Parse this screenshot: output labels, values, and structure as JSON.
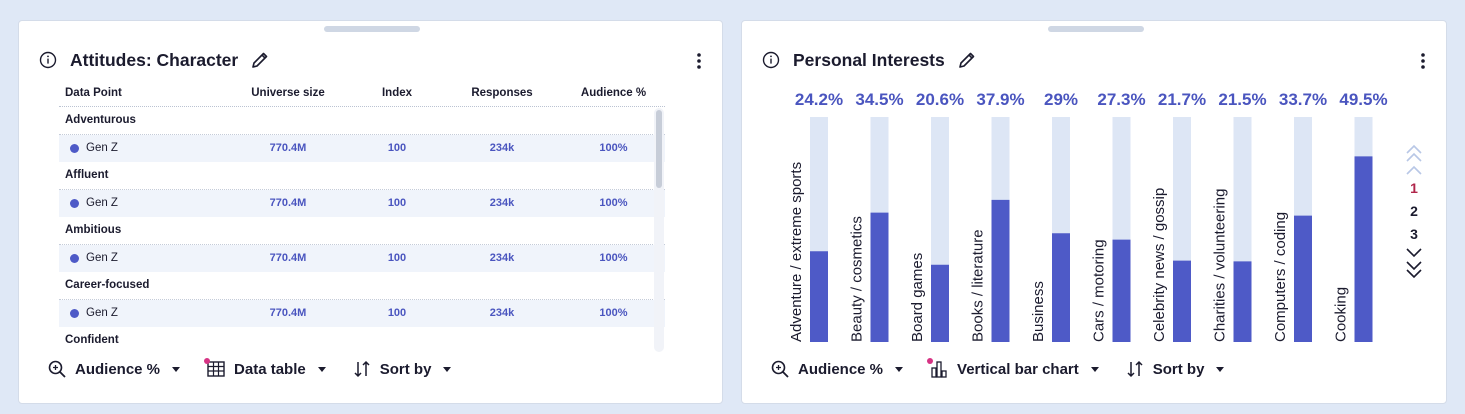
{
  "left_panel": {
    "title": "Attitudes: Character",
    "columns": [
      "Data Point",
      "Universe size",
      "Index",
      "Responses",
      "Audience %"
    ],
    "groups": [
      {
        "name": "Adventurous",
        "rows": [
          {
            "label": "Gen Z",
            "universe": "770.4M",
            "index": "100",
            "responses": "234k",
            "audience": "100%"
          }
        ]
      },
      {
        "name": "Affluent",
        "rows": [
          {
            "label": "Gen Z",
            "universe": "770.4M",
            "index": "100",
            "responses": "234k",
            "audience": "100%"
          }
        ]
      },
      {
        "name": "Ambitious",
        "rows": [
          {
            "label": "Gen Z",
            "universe": "770.4M",
            "index": "100",
            "responses": "234k",
            "audience": "100%"
          }
        ]
      },
      {
        "name": "Career-focused",
        "rows": [
          {
            "label": "Gen Z",
            "universe": "770.4M",
            "index": "100",
            "responses": "234k",
            "audience": "100%"
          }
        ]
      },
      {
        "name": "Confident",
        "rows": []
      }
    ],
    "footer": {
      "metric_label": "Audience %",
      "view_label": "Data table",
      "sort_label": "Sort by"
    }
  },
  "right_panel": {
    "title": "Personal Interests",
    "footer": {
      "metric_label": "Audience %",
      "view_label": "Vertical bar chart",
      "sort_label": "Sort by"
    },
    "pager": {
      "pages": [
        "1",
        "2",
        "3"
      ],
      "current": "1"
    }
  },
  "chart_data": {
    "type": "bar",
    "orientation": "vertical",
    "categories": [
      "Adventure / extreme sports",
      "Beauty / cosmetics",
      "Board games",
      "Books / literature",
      "Business",
      "Cars / motoring",
      "Celebrity news / gossip",
      "Charities / volunteering",
      "Computers / coding",
      "Cooking"
    ],
    "values": [
      24.2,
      34.5,
      20.6,
      37.9,
      29,
      27.3,
      21.7,
      21.5,
      33.7,
      49.5
    ],
    "value_labels": [
      "24.2%",
      "34.5%",
      "20.6%",
      "37.9%",
      "29%",
      "27.3%",
      "21.7%",
      "21.5%",
      "33.7%",
      "49.5%"
    ],
    "ylim": [
      0,
      60
    ],
    "grid": false,
    "colors": {
      "bar": "#4e5ac7",
      "track": "#dde6f5",
      "label": "#4a55bf"
    }
  },
  "colors": {
    "accent": "#4a55bf",
    "background": "#dfe8f6",
    "pager_active": "#b0254a",
    "badge": "#d63384"
  }
}
